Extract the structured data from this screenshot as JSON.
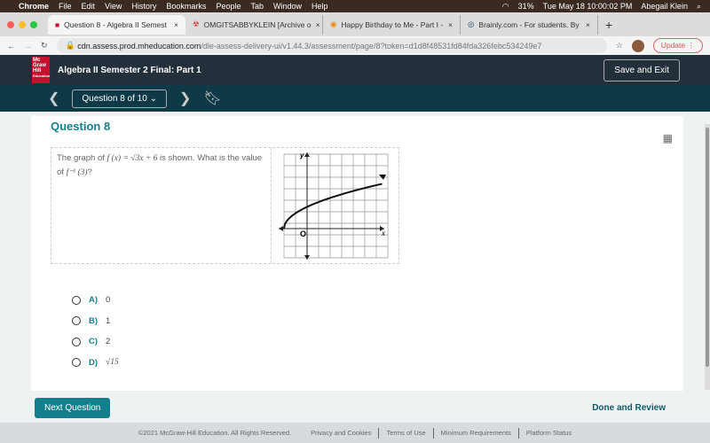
{
  "menubar": {
    "app": "Chrome",
    "items": [
      "File",
      "Edit",
      "View",
      "History",
      "Bookmarks",
      "People",
      "Tab",
      "Window",
      "Help"
    ],
    "battery": "31%",
    "datetime": "Tue May 18  10:00:02 PM",
    "user": "Abegail Klein"
  },
  "tabs": [
    {
      "label": "Question 8 - Algebra II Semest"
    },
    {
      "label": "OMGITSABBYKLEIN [Archive o"
    },
    {
      "label": "Happy Birthday to Me - Part I -"
    },
    {
      "label": "Brainly.com - For students. By"
    }
  ],
  "address": {
    "host": "cdn.assess.prod.mheducation.com",
    "path": "/dle-assess-delivery-ui/v1.44.3/assessment/page/8?token=d1d8f48531fd84fda326febc534249e7",
    "update": "Update"
  },
  "header": {
    "logo": "Mc Graw Hill Education",
    "title": "Algebra II Semester 2 Final: Part 1",
    "save_exit": "Save and Exit"
  },
  "nav": {
    "question_select": "Question 8 of 10"
  },
  "question": {
    "title": "Question 8",
    "text_pre": "The graph of ",
    "fx": "f (x)  = √3x + 6",
    "text_mid": " is shown. What is the value of ",
    "finv": "f⁻¹ (3)",
    "text_post": "?",
    "graph": {
      "y_label": "y",
      "x_label": "x",
      "origin_label": "O"
    }
  },
  "choices": [
    {
      "letter": "A)",
      "value": "0"
    },
    {
      "letter": "B)",
      "value": "1"
    },
    {
      "letter": "C)",
      "value": "2"
    },
    {
      "letter": "D)",
      "value": "√15"
    }
  ],
  "footer_actions": {
    "next": "Next Question",
    "done": "Done and Review"
  },
  "footer": {
    "copyright": "©2021 McGraw-Hill Education. All Rights Reserved.",
    "links": [
      "Privacy and Cookies",
      "Terms of Use",
      "Minimum Requirements",
      "Platform Status"
    ]
  }
}
